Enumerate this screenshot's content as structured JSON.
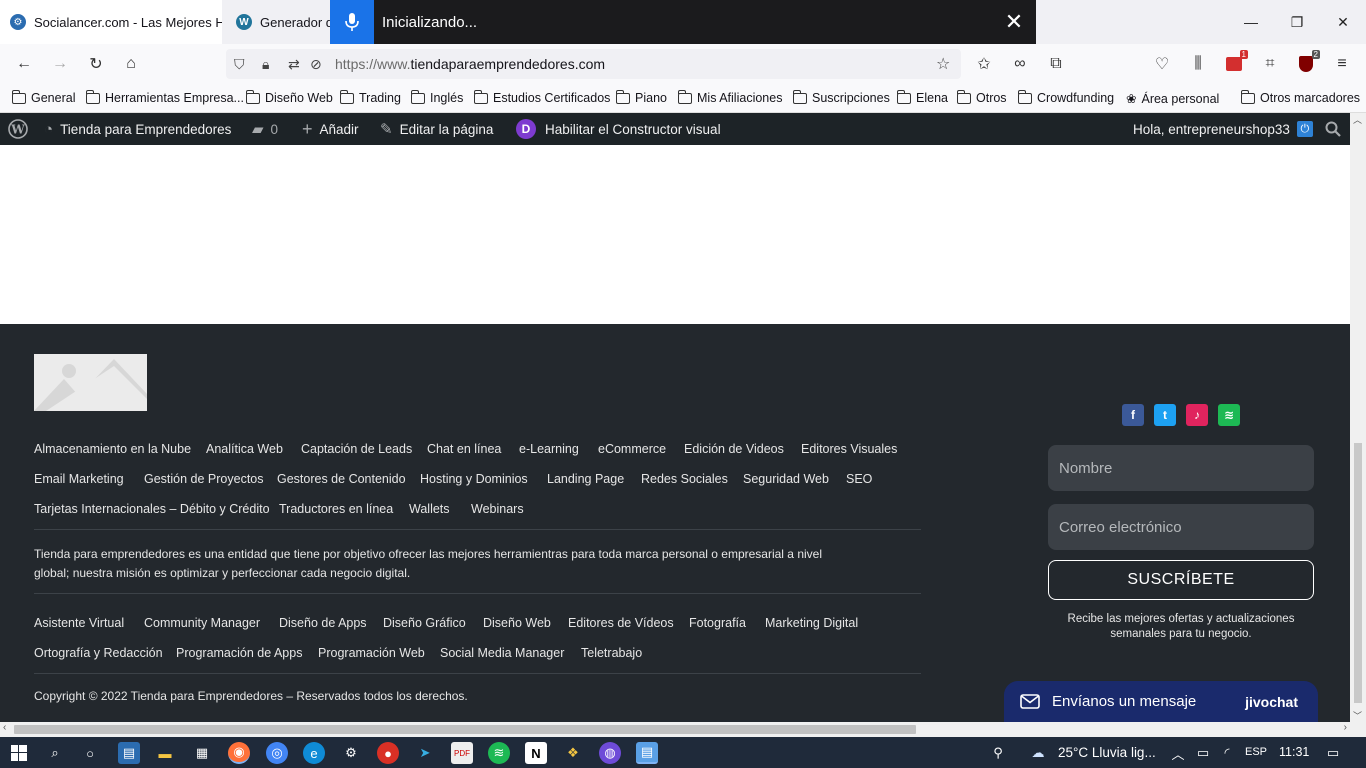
{
  "browser": {
    "tabs": [
      {
        "title": "Socialancer.com - Las Mejores H",
        "icon": "settings-favicon-icon"
      },
      {
        "title": "Generador de",
        "icon": "wordpress-icon"
      }
    ],
    "voice_overlay": {
      "status": "Inicializando..."
    },
    "url": {
      "protocol": "https://www.",
      "host": "tiendaparaemprendedores.com"
    },
    "extension_badges": {
      "first": "1",
      "second": "2"
    },
    "bookmarks": [
      "General",
      "Herramientas Empresa...",
      "Diseño Web",
      "Trading",
      "Inglés",
      "Estudios Certificados",
      "Piano",
      "Mis Afiliaciones",
      "Suscripciones",
      "Elena",
      "Otros",
      "Crowdfunding",
      "Área personal",
      "Otros marcadores"
    ]
  },
  "wp_admin_bar": {
    "site_name": "Tienda para Emprendedores",
    "comments_count": "0",
    "add_label": "Añadir",
    "edit_label": "Editar la página",
    "divi_badge": "D",
    "divi_label": "Habilitar el Constructor visual",
    "greeting": "Hola, entrepreneurshop33"
  },
  "footer": {
    "categories_row1": [
      "Almacenamiento en la Nube",
      "Analítica Web",
      "Captación de Leads",
      "Chat en línea",
      "e-Learning",
      "eCommerce",
      "Edición de Videos",
      "Editores Visuales"
    ],
    "categories_row2": [
      "Email Marketing",
      "Gestión de Proyectos",
      "Gestores de Contenido",
      "Hosting y Dominios",
      "Landing Page",
      "Redes Sociales",
      "Seguridad Web",
      "SEO"
    ],
    "categories_row3": [
      "Tarjetas Internacionales – Débito y Crédito",
      "Traductores en línea",
      "Wallets",
      "Webinars"
    ],
    "description": "Tienda para emprendedores es una entidad que tiene por objetivo ofrecer las mejores herramientras para toda marca personal o empresarial a nivel global; nuestra misión es optimizar y perfeccionar cada negocio digital.",
    "services_row1": [
      "Asistente Virtual",
      "Community Manager",
      "Diseño de Apps",
      "Diseño Gráfico",
      "Diseño Web",
      "Editores de Vídeos",
      "Fotografía",
      "Marketing Digital"
    ],
    "services_row2": [
      "Ortografía y Redacción",
      "Programación de Apps",
      "Programación Web",
      "Social Media Manager",
      "Teletrabajo"
    ],
    "copyright": "Copyright © 2022 Tienda para Emprendedores – Reservados todos los derechos.",
    "social": [
      {
        "icon": "facebook-icon",
        "glyph": "f",
        "color": "#3b5998"
      },
      {
        "icon": "twitter-icon",
        "glyph": "t",
        "color": "#1da1f2"
      },
      {
        "icon": "tiktok-icon",
        "glyph": "♪",
        "color": "#e0245e"
      },
      {
        "icon": "spotify-icon",
        "glyph": "≋",
        "color": "#1db954"
      }
    ],
    "newsletter": {
      "name_placeholder": "Nombre",
      "email_placeholder": "Correo electrónico",
      "button": "SUSCRÍBETE",
      "note": "Recibe las mejores ofertas y actualizaciones semanales para tu negocio."
    },
    "chat": {
      "label": "Envíanos un mensaje",
      "brand": "jivochat"
    }
  },
  "taskbar": {
    "weather": "25°C  Lluvia lig...",
    "language": "ESP",
    "time": "11:31"
  }
}
